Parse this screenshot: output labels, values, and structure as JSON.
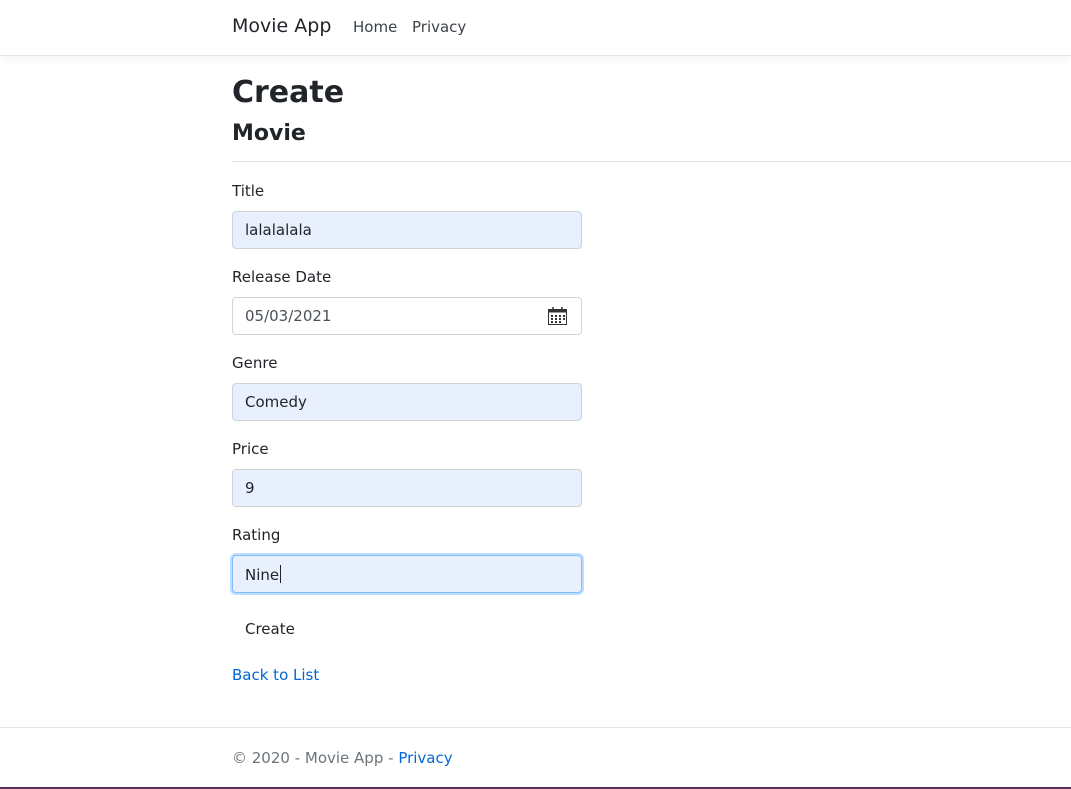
{
  "navbar": {
    "brand": "Movie App",
    "links": [
      "Home",
      "Privacy"
    ]
  },
  "page": {
    "title": "Create",
    "subtitle": "Movie"
  },
  "form": {
    "title": {
      "label": "Title",
      "value": "lalalalala"
    },
    "release_date": {
      "label": "Release Date",
      "value": "05/03/2021"
    },
    "genre": {
      "label": "Genre",
      "value": "Comedy"
    },
    "price": {
      "label": "Price",
      "value": "9"
    },
    "rating": {
      "label": "Rating",
      "value": "Nine"
    },
    "submit_label": "Create"
  },
  "back_link": "Back to List",
  "footer": {
    "text": "© 2020 - Movie App - ",
    "link": "Privacy"
  },
  "colors": {
    "autofill_bg": "#e8f0fe",
    "link": "#0366d6",
    "focus_border": "#80bdff"
  },
  "icons": {
    "date_picker": "calendar-icon"
  }
}
